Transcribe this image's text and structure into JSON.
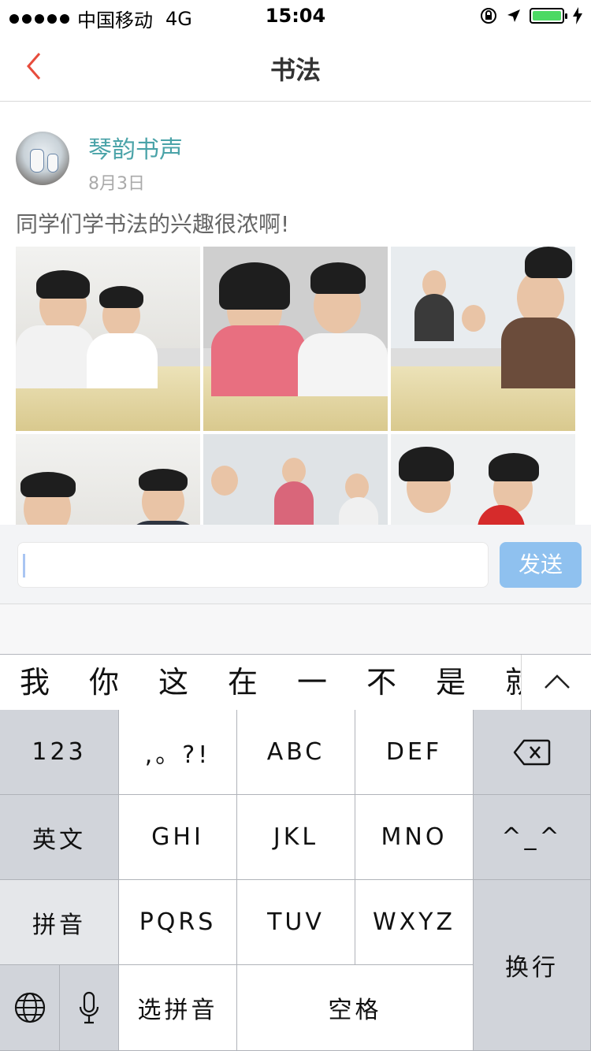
{
  "status_bar": {
    "carrier": "中国移动",
    "network": "4G",
    "time": "15:04"
  },
  "nav": {
    "title": "书法",
    "back_icon": "chevron-left-icon"
  },
  "post": {
    "author": "琴韵书声",
    "date": "8月3日",
    "text": "同学们学书法的兴趣很浓啊!",
    "photo_count_visible": 6
  },
  "composer": {
    "placeholder": "",
    "send_label": "发送"
  },
  "keyboard": {
    "candidates": [
      "我",
      "你",
      "这",
      "在",
      "一",
      "不",
      "是",
      "就"
    ],
    "keys": {
      "numbers": "123",
      "punct": ",。?!",
      "abc": "ABC",
      "def": "DEF",
      "english": "英文",
      "ghi": "GHI",
      "jkl": "JKL",
      "mno": "MNO",
      "emoticon": "^_^",
      "pinyin": "拼音",
      "pqrs": "PQRS",
      "tuv": "TUV",
      "wxyz": "WXYZ",
      "select_pinyin": "选拼音",
      "space": "空格",
      "newline": "换行"
    }
  },
  "colors": {
    "accent": "#e74c3c",
    "author": "#4aa3a8",
    "send": "#8fc1ef",
    "battery": "#4cd964"
  }
}
